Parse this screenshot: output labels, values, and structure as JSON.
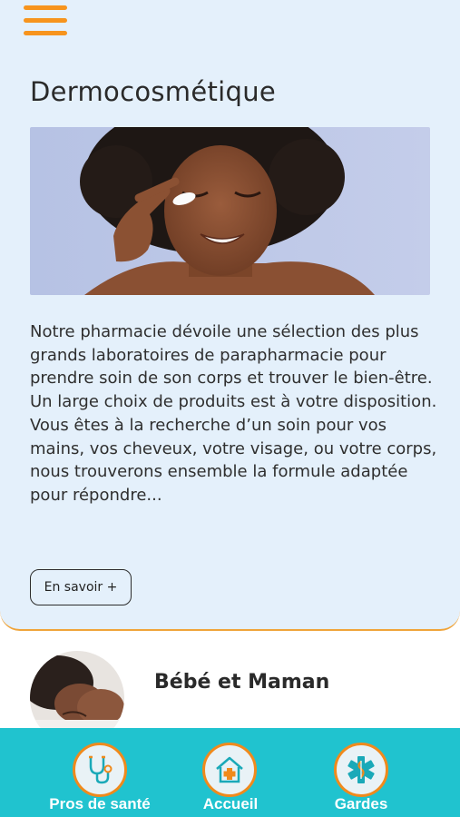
{
  "header": {
    "menu_icon": "hamburger-menu-icon"
  },
  "article": {
    "title": "Dermocosmétique",
    "image_description": "hero-image",
    "body": "Notre pharmacie dévoile une sélection des plus grands laboratoires de parapharmacie pour prendre soin de son corps et trouver le bien-être. Un large choix de produits est à votre disposition. Vous êtes à la recherche d’un soin pour vos mains, vos cheveux, votre visage, ou votre corps, nous trouverons ensemble la formule adaptée pour répondre...",
    "more_label": "En savoir +"
  },
  "next_section": {
    "title": "Bébé et Maman"
  },
  "bottom_nav": {
    "items": [
      {
        "label": "Pros de santé",
        "icon": "stethoscope-icon"
      },
      {
        "label": "Accueil",
        "icon": "home-medical-icon"
      },
      {
        "label": "Gardes",
        "icon": "medical-star-icon"
      }
    ]
  },
  "colors": {
    "accent_orange": "#f7941d",
    "card_background": "#e4f0fb",
    "nav_background": "#20c3cf",
    "icon_teal": "#1aa9b8"
  }
}
